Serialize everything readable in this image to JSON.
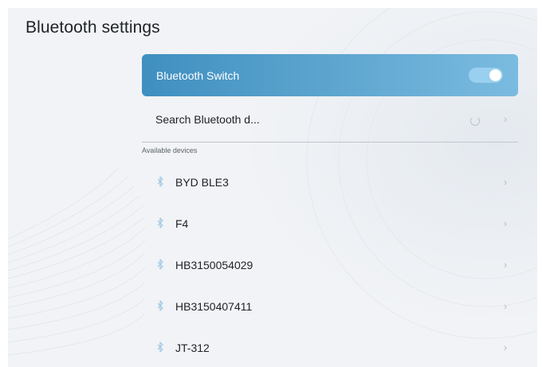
{
  "header": {
    "title": "Bluetooth settings"
  },
  "switch": {
    "label": "Bluetooth Switch",
    "enabled": true
  },
  "search": {
    "label": "Search Bluetooth d...",
    "searching": true
  },
  "section": {
    "available_label": "Available devices"
  },
  "devices": [
    {
      "name": "BYD BLE3"
    },
    {
      "name": "F4"
    },
    {
      "name": "HB3150054029"
    },
    {
      "name": "HB3150407411"
    },
    {
      "name": "JT-312"
    }
  ],
  "icons": {
    "device": "bluetooth-icon",
    "row_action": "chevron-right-icon",
    "search_status": "loading-spinner-icon"
  },
  "colors": {
    "accent": "#4a98c7",
    "toggle_track": "#9ad0ef",
    "background": "#f1f3f6",
    "text": "#1e2226"
  }
}
